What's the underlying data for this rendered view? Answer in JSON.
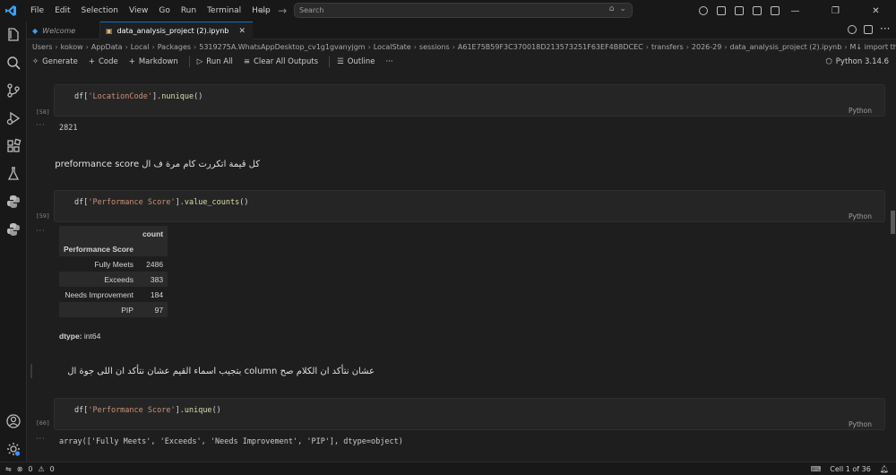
{
  "menu": [
    "File",
    "Edit",
    "Selection",
    "View",
    "Go",
    "Run",
    "Terminal",
    "Help"
  ],
  "search": {
    "placeholder": "Search"
  },
  "tabs": [
    {
      "label": "Welcome"
    },
    {
      "label": "data_analysis_project (2).ipynb"
    }
  ],
  "breadcrumb": [
    "Users",
    "kokow",
    "AppData",
    "Local",
    "Packages",
    "5319275A.WhatsAppDesktop_cv1g1gvanyjgm",
    "LocalState",
    "sessions",
    "A61E75B59F3C370018D213573251F63EF4B8DCEC",
    "transfers",
    "2026-29",
    "data_analysis_project (2).ipynb",
    "M↓ import the libraries"
  ],
  "toolbar": {
    "generate": "Generate",
    "code": "Code",
    "markdown": "Markdown",
    "run_all": "Run All",
    "clear_outputs": "Clear All Outputs",
    "outline": "Outline",
    "more": "···",
    "kernel": "Python 3.14.6"
  },
  "cells": {
    "c1": {
      "exec": "[58]",
      "code_pre": "df[",
      "code_str": "'LocationCode'",
      "code_mid": "].",
      "code_fn": "nunique",
      "code_post": "()",
      "lang": "Python",
      "output": "2821"
    },
    "md1": "كل قيمة اتكررت كام مرة ف ال preformance score",
    "c2": {
      "exec": "[59]",
      "code_pre": "df[",
      "code_str": "'Performance Score'",
      "code_mid": "].",
      "code_fn": "value_counts",
      "code_post": "()",
      "lang": "Python"
    },
    "table": {
      "count_header": "count",
      "index_header": "Performance Score",
      "rows": [
        {
          "label": "Fully Meets",
          "value": "2486"
        },
        {
          "label": "Exceeds",
          "value": "383"
        },
        {
          "label": "Needs Improvement",
          "value": "184"
        },
        {
          "label": "PIP",
          "value": "97"
        }
      ],
      "dtype_label": "dtype:",
      "dtype_value": "int64"
    },
    "md2": "عشان نتأكد ان الكلام صح column بتجيب اسماء القيم عشان نتأكد ان اللى جوة ال",
    "c3": {
      "exec": "[60]",
      "code_pre": "df[",
      "code_str": "'Performance Score'",
      "code_mid": "].",
      "code_fn": "unique",
      "code_post": "()",
      "lang": "Python",
      "output": "array(['Fully Meets', 'Exceeds', 'Needs Improvement', 'PIP'], dtype=object)"
    }
  },
  "status": {
    "errors": "0",
    "warnings": "0",
    "cell_position": "Cell 1 of 36"
  },
  "colors": {
    "accent": "#0078d4",
    "background": "#1e1e1e",
    "string": "#ce9178",
    "function": "#dcdcaa"
  }
}
